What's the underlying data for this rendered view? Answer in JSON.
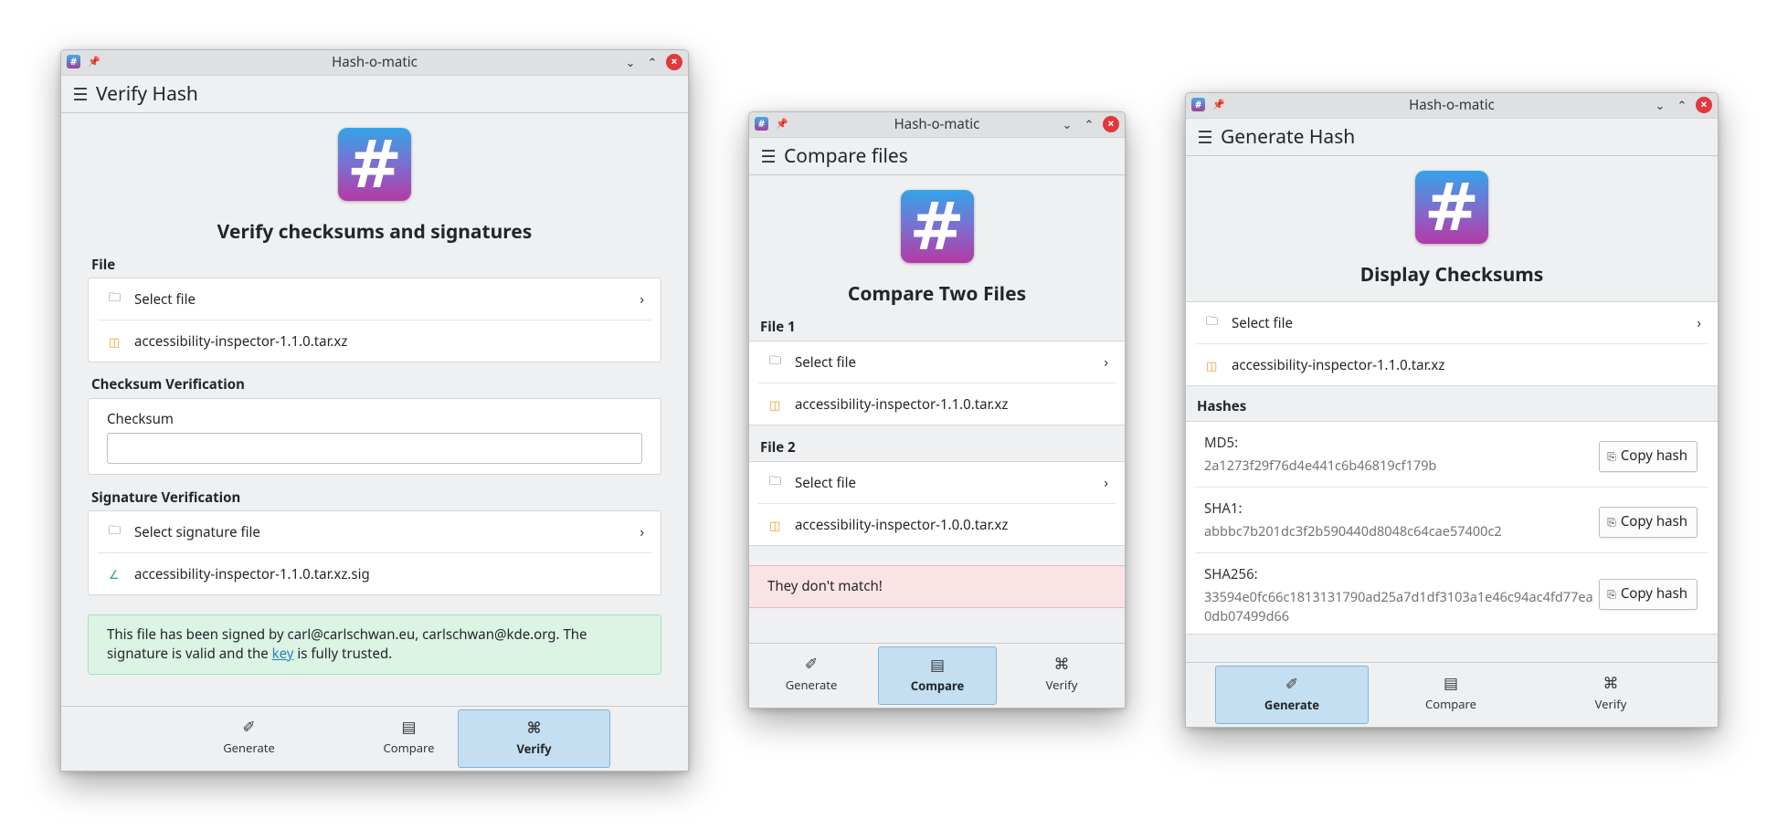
{
  "app_title": "Hash-o-matic",
  "icons": {
    "app": "#",
    "pin": "📌",
    "minimize": "⌄",
    "maximize": "⌃",
    "close": "×",
    "menu": "☰",
    "folder": "🗀",
    "file": "◫",
    "signature": "∠",
    "chevron": "›",
    "copy": "⎘",
    "generate": "✐",
    "compare": "▤",
    "verify": "⌘"
  },
  "colors": {
    "accent": "#3daee9",
    "active_nav": "#c4dff1",
    "success_bg": "#dcf4e4",
    "error_bg": "#f9e3e4",
    "close_button": "#e0383c"
  },
  "nav": {
    "generate": "Generate",
    "compare": "Compare",
    "verify": "Verify"
  },
  "verify_window": {
    "page_title": "Verify Hash",
    "headline": "Verify checksums and signatures",
    "file_label": "File",
    "select_file": "Select file",
    "file_name": "accessibility-inspector-1.1.0.tar.xz",
    "checksum_section": "Checksum Verification",
    "checksum_label": "Checksum",
    "checksum_value": "",
    "signature_section": "Signature Verification",
    "select_signature": "Select signature file",
    "signature_file": "accessibility-inspector-1.1.0.tar.xz.sig",
    "message_part1": "This file has been signed by carl@carlschwan.eu, carlschwan@kde.org. The signature is valid and the",
    "message_link": "key",
    "message_part2": "is fully trusted.",
    "active_nav": "verify"
  },
  "compare_window": {
    "page_title": "Compare files",
    "headline": "Compare Two Files",
    "file1_label": "File 1",
    "file2_label": "File 2",
    "select_file": "Select file",
    "file1_name": "accessibility-inspector-1.1.0.tar.xz",
    "file2_name": "accessibility-inspector-1.0.0.tar.xz",
    "result": "They don't match!",
    "active_nav": "compare"
  },
  "generate_window": {
    "page_title": "Generate Hash",
    "headline": "Display Checksums",
    "select_file": "Select file",
    "file_name": "accessibility-inspector-1.1.0.tar.xz",
    "hashes_label": "Hashes",
    "copy_label": "Copy hash",
    "hashes": [
      {
        "name": "MD5:",
        "value": "2a1273f29f76d4e441c6b46819cf179b"
      },
      {
        "name": "SHA1:",
        "value": "abbbc7b201dc3f2b590440d8048c64cae57400c2"
      },
      {
        "name": "SHA256:",
        "value": "33594e0fc66c1813131790ad25a7d1df3103a1e46c94ac4fd77ea0db07499d66"
      }
    ],
    "active_nav": "generate"
  }
}
